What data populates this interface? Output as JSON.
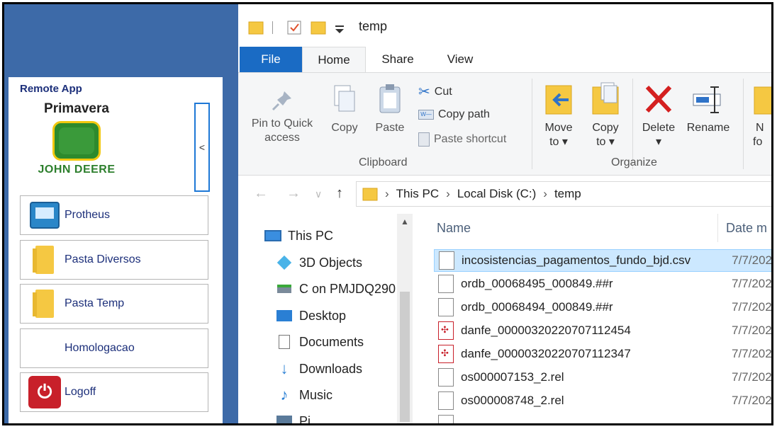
{
  "remote_app": {
    "title": "Remote App",
    "logo_top": "Primavera",
    "logo_bottom": "JOHN DEERE",
    "collapse_glyph": "<",
    "buttons": [
      {
        "label": "Protheus",
        "icon": "monitor-icon"
      },
      {
        "label": "Pasta Diversos",
        "icon": "folder-icon"
      },
      {
        "label": "Pasta Temp",
        "icon": "folder-icon"
      },
      {
        "label": "Homologacao",
        "icon": ""
      },
      {
        "label": "Logoff",
        "icon": "power-icon"
      }
    ]
  },
  "explorer": {
    "window_title": "temp",
    "tabs": {
      "file": "File",
      "home": "Home",
      "share": "Share",
      "view": "View"
    },
    "ribbon": {
      "pin": [
        "Pin to Quick",
        "access"
      ],
      "copy": "Copy",
      "paste": "Paste",
      "cut": "Cut",
      "copy_path": "Copy path",
      "paste_shortcut": "Paste shortcut",
      "clipboard_group": "Clipboard",
      "move_to": [
        "Move",
        "to ▾"
      ],
      "copy_to": [
        "Copy",
        "to ▾"
      ],
      "delete": [
        "Delete",
        "▾"
      ],
      "rename": "Rename",
      "organize_group": "Organize",
      "new_partial": [
        "N",
        "fo"
      ]
    },
    "address": {
      "segments": [
        "This PC",
        "Local Disk (C:)",
        "temp"
      ],
      "separator": "›"
    },
    "nav_pane": [
      {
        "label": "This PC",
        "icon": "computer-icon"
      },
      {
        "label": "3D Objects",
        "icon": "cube-icon"
      },
      {
        "label": "C on PMJDQ290",
        "icon": "network-drive-icon"
      },
      {
        "label": "Desktop",
        "icon": "desktop-icon"
      },
      {
        "label": "Documents",
        "icon": "document-icon"
      },
      {
        "label": "Downloads",
        "icon": "download-icon"
      },
      {
        "label": "Music",
        "icon": "music-icon"
      },
      {
        "label": "Pi",
        "icon": "pictures-icon"
      }
    ],
    "columns": {
      "name": "Name",
      "date": "Date m"
    },
    "files": [
      {
        "name": "incosistencias_pagamentos_fundo_bjd.csv",
        "date": "7/7/202",
        "type": "file",
        "selected": true
      },
      {
        "name": "ordb_00068495_000849.##r",
        "date": "7/7/202",
        "type": "file",
        "selected": false
      },
      {
        "name": "ordb_00068494_000849.##r",
        "date": "7/7/202",
        "type": "file",
        "selected": false
      },
      {
        "name": "danfe_000003202207071 12454",
        "date": "7/7/202",
        "type": "pdf",
        "selected": false
      },
      {
        "name": "danfe_00000320220707112347",
        "date": "7/7/202",
        "type": "pdf",
        "selected": false
      },
      {
        "name": "os000007153_2.rel",
        "date": "7/7/202",
        "type": "file",
        "selected": false
      },
      {
        "name": "os000008748_2.rel",
        "date": "7/7/202",
        "type": "file",
        "selected": false
      }
    ]
  },
  "colors": {
    "remote_bg": "#3d6aa8",
    "file_tab": "#1a6bc4",
    "selection": "#cce8ff",
    "remote_text": "#1c2f7a"
  }
}
